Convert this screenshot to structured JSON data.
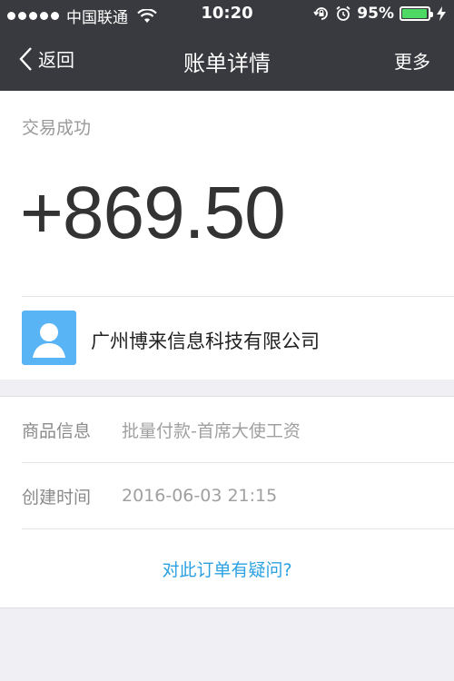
{
  "status_bar": {
    "carrier": "中国联通",
    "time": "10:20",
    "battery_percent": "95%",
    "battery_level": 0.95,
    "icons": [
      "signal-dots-icon",
      "wifi-icon",
      "orientation-lock-icon",
      "alarm-icon",
      "battery-icon",
      "charging-bolt-icon"
    ]
  },
  "nav": {
    "back_label": "返回",
    "title": "账单详情",
    "more_label": "更多"
  },
  "summary": {
    "status": "交易成功",
    "amount": "+869.50",
    "company": "广州博来信息科技有限公司"
  },
  "details": {
    "rows": [
      {
        "label": "商品信息",
        "value": "批量付款-首席大使工资"
      },
      {
        "label": "创建时间",
        "value": "2016-06-03 21:15"
      }
    ],
    "question_link": "对此订单有疑问?"
  },
  "colors": {
    "nav_background": "#393a3f",
    "avatar_background": "#58b4f5",
    "link": "#2ba1e0",
    "battery_fill": "#4cd964"
  }
}
